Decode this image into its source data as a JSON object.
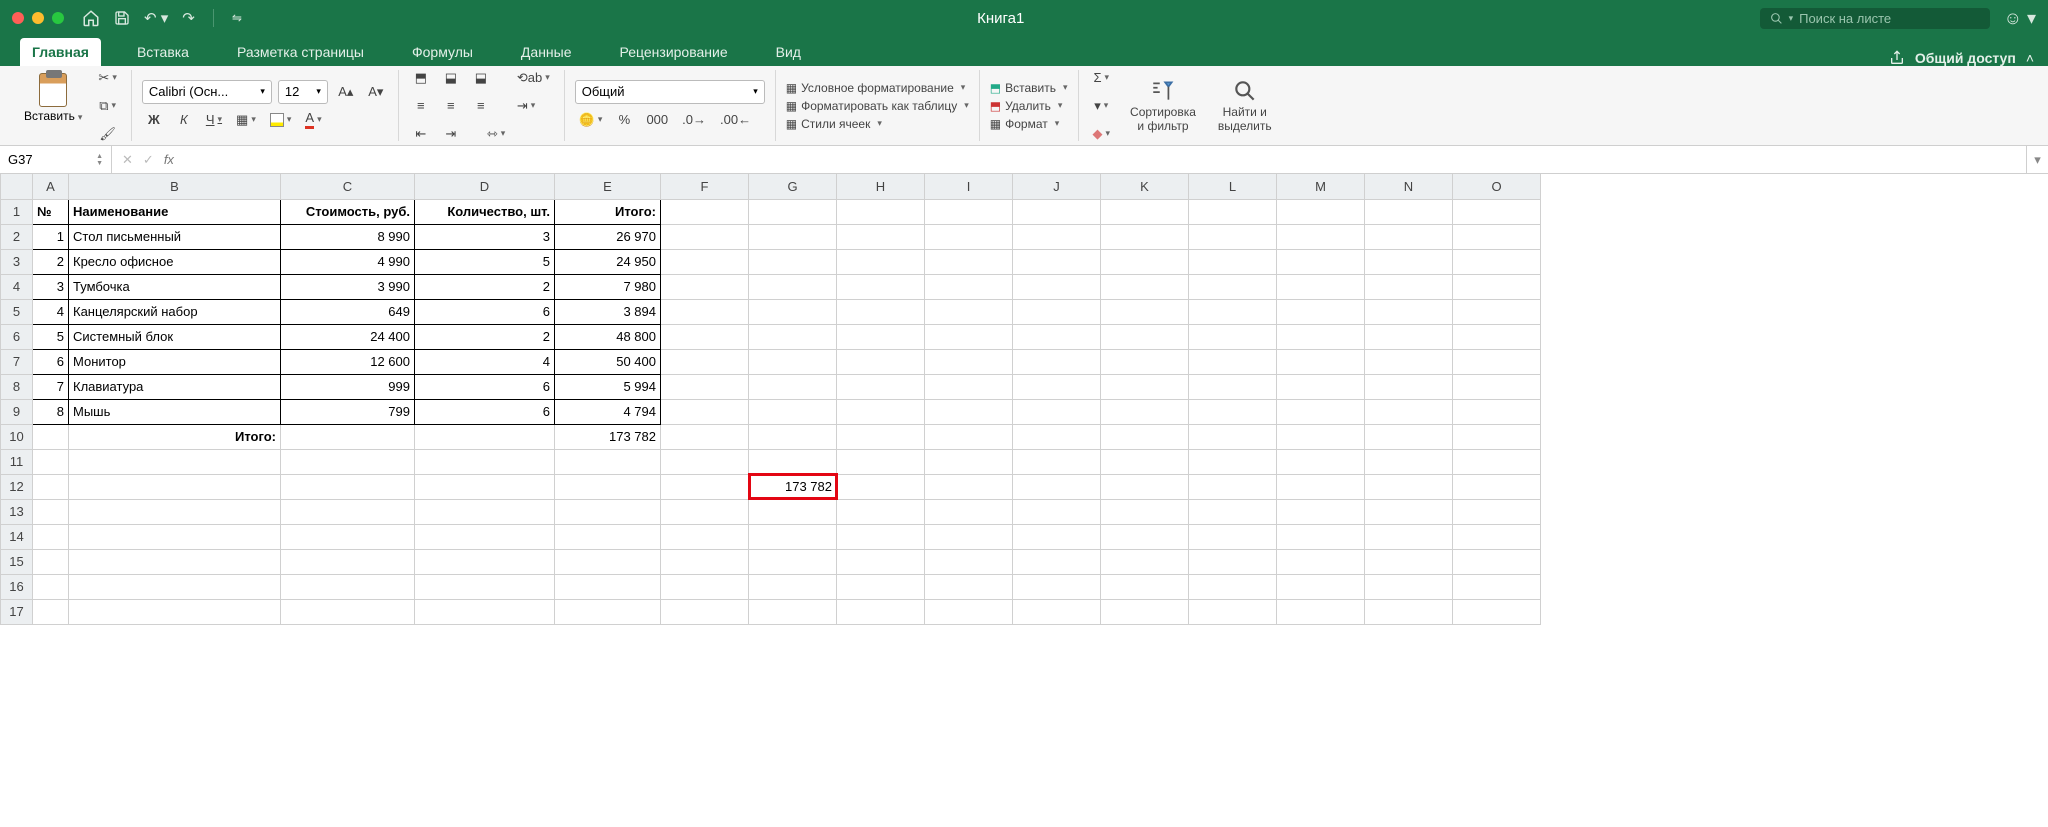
{
  "title": "Книга1",
  "search_placeholder": "Поиск на листе",
  "tabs": [
    "Главная",
    "Вставка",
    "Разметка страницы",
    "Формулы",
    "Данные",
    "Рецензирование",
    "Вид"
  ],
  "share_label": "Общий доступ",
  "ribbon": {
    "paste_label": "Вставить",
    "font_name": "Calibri (Осн...",
    "font_size": "12",
    "bold": "Ж",
    "italic": "К",
    "underline": "Ч",
    "number_format": "Общий",
    "cond_format": "Условное форматирование",
    "format_table": "Форматировать как таблицу",
    "cell_styles": "Стили ячеек",
    "insert": "Вставить",
    "delete": "Удалить",
    "format": "Формат",
    "sort_filter": "Сортировка\nи фильтр",
    "find_select": "Найти и\nвыделить"
  },
  "name_box": "G37",
  "fx": "fx",
  "columns": [
    "A",
    "B",
    "C",
    "D",
    "E",
    "F",
    "G",
    "H",
    "I",
    "J",
    "K",
    "L",
    "M",
    "N",
    "O"
  ],
  "headers": {
    "num": "№",
    "name": "Наименование",
    "cost": "Стоимость, руб.",
    "qty": "Количество, шт.",
    "total": "Итого:"
  },
  "rows": [
    {
      "n": "1",
      "name": "Стол письменный",
      "cost": "8 990",
      "qty": "3",
      "total": "26 970"
    },
    {
      "n": "2",
      "name": "Кресло офисное",
      "cost": "4 990",
      "qty": "5",
      "total": "24 950"
    },
    {
      "n": "3",
      "name": "Тумбочка",
      "cost": "3 990",
      "qty": "2",
      "total": "7 980"
    },
    {
      "n": "4",
      "name": "Канцелярский набор",
      "cost": "649",
      "qty": "6",
      "total": "3 894"
    },
    {
      "n": "5",
      "name": "Системный блок",
      "cost": "24 400",
      "qty": "2",
      "total": "48 800"
    },
    {
      "n": "6",
      "name": "Монитор",
      "cost": "12 600",
      "qty": "4",
      "total": "50 400"
    },
    {
      "n": "7",
      "name": "Клавиатура",
      "cost": "999",
      "qty": "6",
      "total": "5 994"
    },
    {
      "n": "8",
      "name": "Мышь",
      "cost": "799",
      "qty": "6",
      "total": "4 794"
    }
  ],
  "total_label": "Итого:",
  "grand_total": "173 782",
  "g12_value": "173 782"
}
